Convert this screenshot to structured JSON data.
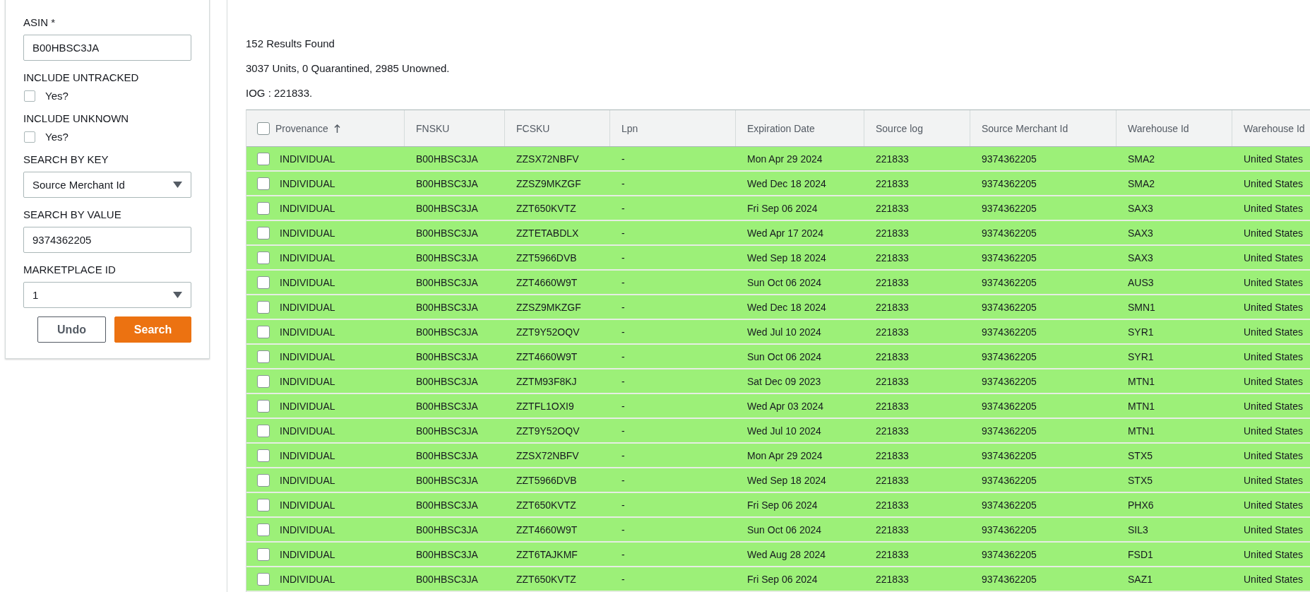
{
  "filters": {
    "asin": {
      "label": "ASIN *",
      "value": "B00HBSC3JA"
    },
    "include_untracked": {
      "label": "INCLUDE UNTRACKED",
      "option": "Yes?",
      "checked": false
    },
    "include_unknown": {
      "label": "INCLUDE UNKNOWN",
      "option": "Yes?",
      "checked": false
    },
    "search_by_key": {
      "label": "SEARCH BY KEY",
      "value": "Source Merchant Id"
    },
    "search_by_value": {
      "label": "SEARCH BY VALUE",
      "value": "9374362205"
    },
    "marketplace_id": {
      "label": "MARKETPLACE ID",
      "value": "1"
    },
    "buttons": [
      {
        "label": "Undo",
        "kind": "secondary"
      },
      {
        "label": "Search",
        "kind": "primary"
      }
    ]
  },
  "summary": [
    "152 Results Found",
    "3037 Units, 0 Quarantined, 2985 Unowned.",
    "IOG : 221833."
  ],
  "table": {
    "select_all_checked": false,
    "columns": [
      {
        "label": "Provenance",
        "sorted": true
      },
      {
        "label": "FNSKU",
        "sorted": false
      },
      {
        "label": "FCSKU",
        "sorted": false
      },
      {
        "label": "Lpn",
        "sorted": false
      },
      {
        "label": "Expiration Date",
        "sorted": false
      },
      {
        "label": "Source log",
        "sorted": false
      },
      {
        "label": "Source Merchant Id",
        "sorted": false
      },
      {
        "label": "Warehouse Id",
        "sorted": false
      },
      {
        "label": "Warehouse Id",
        "sorted": false
      }
    ],
    "rows": [
      {
        "checked": false,
        "highlighted": true,
        "cells": [
          "INDIVIDUAL",
          "B00HBSC3JA",
          "ZZSX72NBFV",
          "-",
          "Mon Apr 29 2024",
          "221833",
          "9374362205",
          "SMA2",
          "United States"
        ]
      },
      {
        "checked": false,
        "highlighted": true,
        "cells": [
          "INDIVIDUAL",
          "B00HBSC3JA",
          "ZZSZ9MKZGF",
          "-",
          "Wed Dec 18 2024",
          "221833",
          "9374362205",
          "SMA2",
          "United States"
        ]
      },
      {
        "checked": false,
        "highlighted": true,
        "cells": [
          "INDIVIDUAL",
          "B00HBSC3JA",
          "ZZT650KVTZ",
          "-",
          "Fri Sep 06 2024",
          "221833",
          "9374362205",
          "SAX3",
          "United States"
        ]
      },
      {
        "checked": false,
        "highlighted": true,
        "cells": [
          "INDIVIDUAL",
          "B00HBSC3JA",
          "ZZTETABDLX",
          "-",
          "Wed Apr 17 2024",
          "221833",
          "9374362205",
          "SAX3",
          "United States"
        ]
      },
      {
        "checked": false,
        "highlighted": true,
        "cells": [
          "INDIVIDUAL",
          "B00HBSC3JA",
          "ZZT5966DVB",
          "-",
          "Wed Sep 18 2024",
          "221833",
          "9374362205",
          "SAX3",
          "United States"
        ]
      },
      {
        "checked": false,
        "highlighted": true,
        "cells": [
          "INDIVIDUAL",
          "B00HBSC3JA",
          "ZZT4660W9T",
          "-",
          "Sun Oct 06 2024",
          "221833",
          "9374362205",
          "AUS3",
          "United States"
        ]
      },
      {
        "checked": false,
        "highlighted": true,
        "cells": [
          "INDIVIDUAL",
          "B00HBSC3JA",
          "ZZSZ9MKZGF",
          "-",
          "Wed Dec 18 2024",
          "221833",
          "9374362205",
          "SMN1",
          "United States"
        ]
      },
      {
        "checked": false,
        "highlighted": true,
        "cells": [
          "INDIVIDUAL",
          "B00HBSC3JA",
          "ZZT9Y52OQV",
          "-",
          "Wed Jul 10 2024",
          "221833",
          "9374362205",
          "SYR1",
          "United States"
        ]
      },
      {
        "checked": false,
        "highlighted": true,
        "cells": [
          "INDIVIDUAL",
          "B00HBSC3JA",
          "ZZT4660W9T",
          "-",
          "Sun Oct 06 2024",
          "221833",
          "9374362205",
          "SYR1",
          "United States"
        ]
      },
      {
        "checked": false,
        "highlighted": true,
        "cells": [
          "INDIVIDUAL",
          "B00HBSC3JA",
          "ZZTM93F8KJ",
          "-",
          "Sat Dec 09 2023",
          "221833",
          "9374362205",
          "MTN1",
          "United States"
        ]
      },
      {
        "checked": false,
        "highlighted": true,
        "cells": [
          "INDIVIDUAL",
          "B00HBSC3JA",
          "ZZTFL1OXI9",
          "-",
          "Wed Apr 03 2024",
          "221833",
          "9374362205",
          "MTN1",
          "United States"
        ]
      },
      {
        "checked": false,
        "highlighted": true,
        "cells": [
          "INDIVIDUAL",
          "B00HBSC3JA",
          "ZZT9Y52OQV",
          "-",
          "Wed Jul 10 2024",
          "221833",
          "9374362205",
          "MTN1",
          "United States"
        ]
      },
      {
        "checked": false,
        "highlighted": true,
        "cells": [
          "INDIVIDUAL",
          "B00HBSC3JA",
          "ZZSX72NBFV",
          "-",
          "Mon Apr 29 2024",
          "221833",
          "9374362205",
          "STX5",
          "United States"
        ]
      },
      {
        "checked": false,
        "highlighted": true,
        "cells": [
          "INDIVIDUAL",
          "B00HBSC3JA",
          "ZZT5966DVB",
          "-",
          "Wed Sep 18 2024",
          "221833",
          "9374362205",
          "STX5",
          "United States"
        ]
      },
      {
        "checked": false,
        "highlighted": true,
        "cells": [
          "INDIVIDUAL",
          "B00HBSC3JA",
          "ZZT650KVTZ",
          "-",
          "Fri Sep 06 2024",
          "221833",
          "9374362205",
          "PHX6",
          "United States"
        ]
      },
      {
        "checked": false,
        "highlighted": true,
        "cells": [
          "INDIVIDUAL",
          "B00HBSC3JA",
          "ZZT4660W9T",
          "-",
          "Sun Oct 06 2024",
          "221833",
          "9374362205",
          "SIL3",
          "United States"
        ]
      },
      {
        "checked": false,
        "highlighted": true,
        "cells": [
          "INDIVIDUAL",
          "B00HBSC3JA",
          "ZZT6TAJKMF",
          "-",
          "Wed Aug 28 2024",
          "221833",
          "9374362205",
          "FSD1",
          "United States"
        ]
      },
      {
        "checked": false,
        "highlighted": true,
        "cells": [
          "INDIVIDUAL",
          "B00HBSC3JA",
          "ZZT650KVTZ",
          "-",
          "Fri Sep 06 2024",
          "221833",
          "9374362205",
          "SAZ1",
          "United States"
        ]
      }
    ]
  }
}
